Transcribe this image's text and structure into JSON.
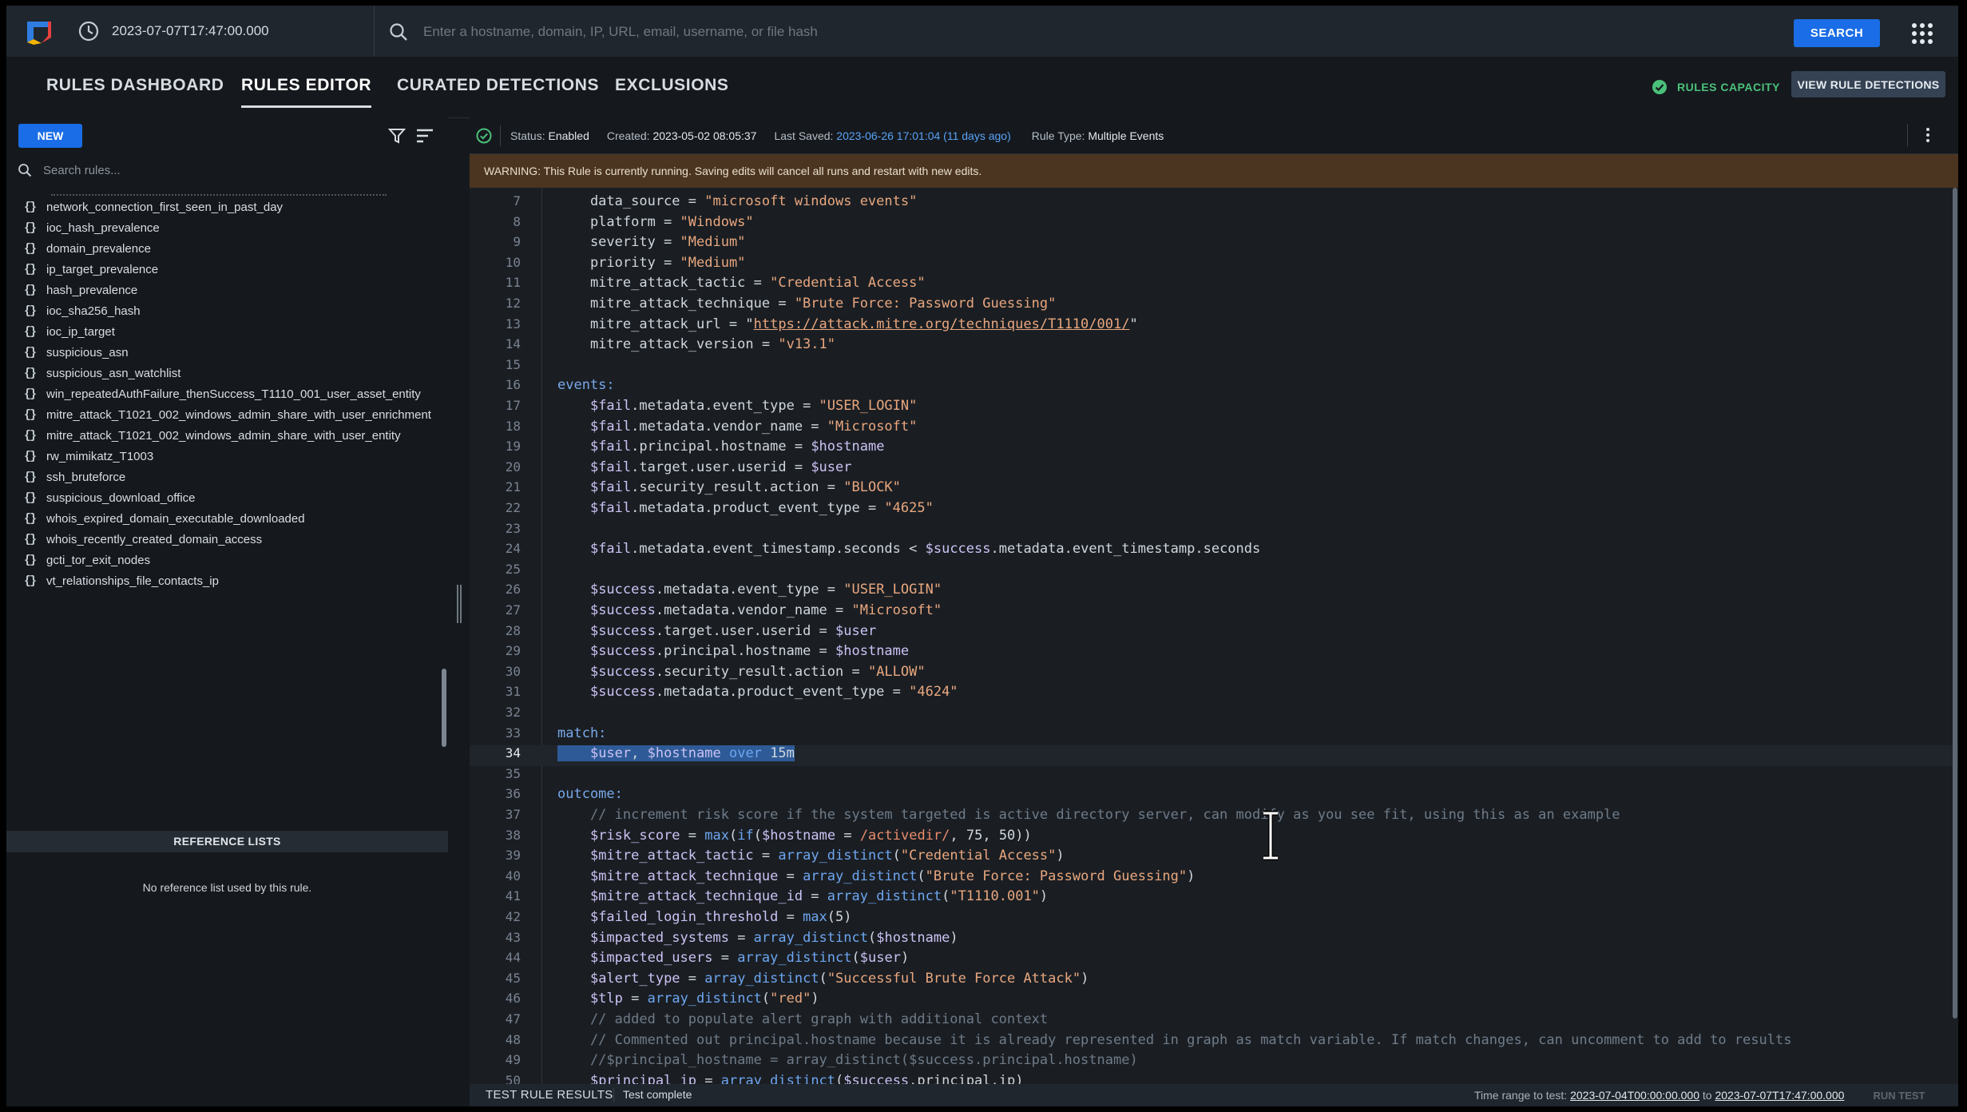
{
  "topbar": {
    "timestamp": "2023-07-07T17:47:00.000",
    "search_placeholder": "Enter a hostname, domain, IP, URL, email, username, or file hash",
    "search_button": "SEARCH"
  },
  "nav": {
    "tabs": [
      "RULES DASHBOARD",
      "RULES EDITOR",
      "CURATED DETECTIONS",
      "EXCLUSIONS"
    ],
    "active_tab": "RULES EDITOR",
    "rules_capacity": "RULES CAPACITY",
    "view_rule_detections": "VIEW RULE DETECTIONS"
  },
  "sidebar": {
    "new_button": "NEW",
    "search_placeholder": "Search rules...",
    "rules": [
      "network_connection_first_seen_in_past_day",
      "ioc_hash_prevalence",
      "domain_prevalence",
      "ip_target_prevalence",
      "hash_prevalence",
      "ioc_sha256_hash",
      "ioc_ip_target",
      "suspicious_asn",
      "suspicious_asn_watchlist",
      "win_repeatedAuthFailure_thenSuccess_T1110_001_user_asset_entity",
      "mitre_attack_T1021_002_windows_admin_share_with_user_enrichment",
      "mitre_attack_T1021_002_windows_admin_share_with_user_entity",
      "rw_mimikatz_T1003",
      "ssh_bruteforce",
      "suspicious_download_office",
      "whois_expired_domain_executable_downloaded",
      "whois_recently_created_domain_access",
      "gcti_tor_exit_nodes",
      "vt_relationships_file_contacts_ip"
    ],
    "reference_lists_header": "REFERENCE LISTS",
    "reference_lists_empty": "No reference list used by this rule."
  },
  "status": {
    "status_label": "Status:",
    "status_value": "Enabled",
    "created_label": "Created:",
    "created_value": "2023-05-02 08:05:37",
    "last_saved_label": "Last Saved:",
    "last_saved_value": "2023-06-26 17:01:04 (11 days ago)",
    "rule_type_label": "Rule Type:",
    "rule_type_value": "Multiple Events"
  },
  "warning": "WARNING: This Rule is currently running. Saving edits will cancel all runs and restart with new edits.",
  "editor": {
    "highlighted_line": 34,
    "lines": [
      {
        "n": 7,
        "text": "    data_source = \"microsoft windows events\""
      },
      {
        "n": 8,
        "text": "    platform = \"Windows\""
      },
      {
        "n": 9,
        "text": "    severity = \"Medium\""
      },
      {
        "n": 10,
        "text": "    priority = \"Medium\""
      },
      {
        "n": 11,
        "text": "    mitre_attack_tactic = \"Credential Access\""
      },
      {
        "n": 12,
        "text": "    mitre_attack_technique = \"Brute Force: Password Guessing\""
      },
      {
        "n": 13,
        "text": "    mitre_attack_url = \"https://attack.mitre.org/techniques/T1110/001/\""
      },
      {
        "n": 14,
        "text": "    mitre_attack_version = \"v13.1\""
      },
      {
        "n": 15,
        "text": ""
      },
      {
        "n": 16,
        "text": "events:"
      },
      {
        "n": 17,
        "text": "    $fail.metadata.event_type = \"USER_LOGIN\""
      },
      {
        "n": 18,
        "text": "    $fail.metadata.vendor_name = \"Microsoft\""
      },
      {
        "n": 19,
        "text": "    $fail.principal.hostname = $hostname"
      },
      {
        "n": 20,
        "text": "    $fail.target.user.userid = $user"
      },
      {
        "n": 21,
        "text": "    $fail.security_result.action = \"BLOCK\""
      },
      {
        "n": 22,
        "text": "    $fail.metadata.product_event_type = \"4625\""
      },
      {
        "n": 23,
        "text": ""
      },
      {
        "n": 24,
        "text": "    $fail.metadata.event_timestamp.seconds < $success.metadata.event_timestamp.seconds"
      },
      {
        "n": 25,
        "text": ""
      },
      {
        "n": 26,
        "text": "    $success.metadata.event_type = \"USER_LOGIN\""
      },
      {
        "n": 27,
        "text": "    $success.metadata.vendor_name = \"Microsoft\""
      },
      {
        "n": 28,
        "text": "    $success.target.user.userid = $user"
      },
      {
        "n": 29,
        "text": "    $success.principal.hostname = $hostname"
      },
      {
        "n": 30,
        "text": "    $success.security_result.action = \"ALLOW\""
      },
      {
        "n": 31,
        "text": "    $success.metadata.product_event_type = \"4624\""
      },
      {
        "n": 32,
        "text": ""
      },
      {
        "n": 33,
        "text": "match:"
      },
      {
        "n": 34,
        "text": "    $user, $hostname over 15m"
      },
      {
        "n": 35,
        "text": ""
      },
      {
        "n": 36,
        "text": "outcome:"
      },
      {
        "n": 37,
        "text": "    // increment risk score if the system targeted is active directory server, can modify as you see fit, using this as an example"
      },
      {
        "n": 38,
        "text": "    $risk_score = max(if($hostname = /activedir/, 75, 50))"
      },
      {
        "n": 39,
        "text": "    $mitre_attack_tactic = array_distinct(\"Credential Access\")"
      },
      {
        "n": 40,
        "text": "    $mitre_attack_technique = array_distinct(\"Brute Force: Password Guessing\")"
      },
      {
        "n": 41,
        "text": "    $mitre_attack_technique_id = array_distinct(\"T1110.001\")"
      },
      {
        "n": 42,
        "text": "    $failed_login_threshold = max(5)"
      },
      {
        "n": 43,
        "text": "    $impacted_systems = array_distinct($hostname)"
      },
      {
        "n": 44,
        "text": "    $impacted_users = array_distinct($user)"
      },
      {
        "n": 45,
        "text": "    $alert_type = array_distinct(\"Successful Brute Force Attack\")"
      },
      {
        "n": 46,
        "text": "    $tlp = array_distinct(\"red\")"
      },
      {
        "n": 47,
        "text": "    // added to populate alert graph with additional context"
      },
      {
        "n": 48,
        "text": "    // Commented out principal.hostname because it is already represented in graph as match variable. If match changes, can uncomment to add to results"
      },
      {
        "n": 49,
        "text": "    //$principal_hostname = array_distinct($success.principal.hostname)"
      },
      {
        "n": 50,
        "text": "    $principal_ip = array_distinct($success.principal.ip)"
      }
    ]
  },
  "bottom": {
    "title": "TEST RULE RESULTS",
    "status": "Test complete",
    "range_label": "Time range to test:",
    "range_start": "2023-07-04T00:00:00.000",
    "range_to": "to",
    "range_end": "2023-07-07T17:47:00.000",
    "run_test": "RUN TEST"
  },
  "colors": {
    "accent_blue": "#1a6de6",
    "ok_green": "#4bc17a",
    "warning_bg": "#4b3520",
    "selection": "#2e5b97"
  }
}
